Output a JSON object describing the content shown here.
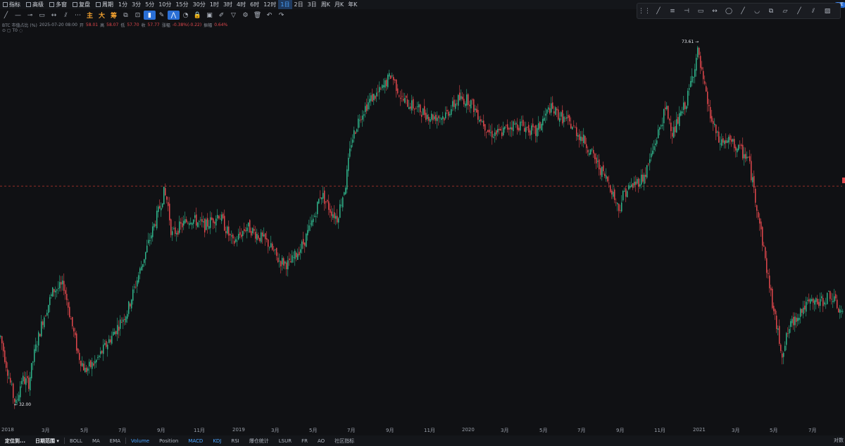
{
  "topbar": {
    "items": [
      {
        "icon": "indicator-icon",
        "label": "指标"
      },
      {
        "icon": "advanced-icon",
        "label": "高级"
      },
      {
        "icon": "multi-window-icon",
        "label": "多窗"
      },
      {
        "icon": "replay-icon",
        "label": "复盘"
      },
      {
        "icon": "period-icon",
        "label": "周期"
      }
    ],
    "intervals": [
      "1分",
      "3分",
      "5分",
      "10分",
      "15分",
      "30分",
      "1时",
      "3时",
      "4时",
      "6时",
      "12时",
      "1日",
      "2日",
      "3日",
      "周K",
      "月K",
      "年K"
    ],
    "active_interval": "1日",
    "badge": "AIE"
  },
  "toolbar": {
    "tools": [
      {
        "name": "trend-line-icon",
        "glyph": "╱"
      },
      {
        "name": "horizontal-line-icon",
        "glyph": "—"
      },
      {
        "name": "ray-icon",
        "glyph": "⊸"
      },
      {
        "name": "rectangle-icon",
        "glyph": "▭"
      },
      {
        "name": "range-icon",
        "glyph": "↔"
      },
      {
        "name": "parallel-channel-icon",
        "glyph": "⫽"
      },
      {
        "name": "dotted-line-icon",
        "glyph": "⋯"
      }
    ],
    "chinese_tools": [
      "主",
      "大",
      "筹"
    ],
    "tools2": [
      {
        "name": "layout-icon",
        "glyph": "⧉"
      },
      {
        "name": "screenshot-icon",
        "glyph": "⊡"
      },
      {
        "name": "bookmark-icon",
        "glyph": "▮",
        "selected": true
      },
      {
        "name": "ruler-icon",
        "glyph": "✎"
      },
      {
        "name": "magnet-icon",
        "glyph": "⋀",
        "selected": true
      },
      {
        "name": "eye-icon",
        "glyph": "◔"
      },
      {
        "name": "lock-icon",
        "glyph": "🔒"
      },
      {
        "name": "clipboard-icon",
        "glyph": "▣"
      },
      {
        "name": "edit-icon",
        "glyph": "✐"
      },
      {
        "name": "filter-icon",
        "glyph": "▽"
      },
      {
        "name": "settings-icon",
        "glyph": "⚙"
      },
      {
        "name": "trash-icon",
        "glyph": "🗑"
      },
      {
        "name": "undo-icon",
        "glyph": "↶"
      },
      {
        "name": "redo-icon",
        "glyph": "↷"
      }
    ]
  },
  "float_toolbar": [
    "⋮⋮",
    "╱",
    "≡",
    "⊣",
    "▭",
    "↔",
    "◯",
    "╱",
    "◡",
    "⧉",
    "▱",
    "╱",
    "⫽",
    "▨"
  ],
  "info": {
    "symbol": "BTC 市值占比 (%)",
    "datetime": "2025-07-20 08:00",
    "open_label": "开",
    "open": "58.01",
    "high_label": "高",
    "high": "58.07",
    "low_label": "低",
    "low": "57.70",
    "close_label": "收",
    "close": "57.77",
    "change_label": "涨幅",
    "change": "-0.38%(-0.22)",
    "amplitude_label": "振幅",
    "amplitude": "0.64%",
    "sub": "T0"
  },
  "annotations": {
    "high_value": "73.61",
    "low_value": "32.00"
  },
  "chart_data": {
    "type": "candlestick",
    "title": "",
    "x_range": [
      "2018-01-01",
      "2021-09-15"
    ],
    "ylim": [
      30,
      76
    ],
    "reference_line": 57.77,
    "colors": {
      "up": "#2fb38a",
      "down": "#e0474c",
      "grid": "none"
    },
    "x_ticks": [
      "2018",
      "3月",
      "5月",
      "7月",
      "9月",
      "11月",
      "2019",
      "3月",
      "5月",
      "7月",
      "9月",
      "11月",
      "2020",
      "3月",
      "5月",
      "7月",
      "9月",
      "11月",
      "2021",
      "3月",
      "5月",
      "7月"
    ],
    "anchors": [
      {
        "t": 0,
        "v": 40
      },
      {
        "t": 10,
        "v": 36
      },
      {
        "t": 18,
        "v": 33
      },
      {
        "t": 22,
        "v": 32
      },
      {
        "t": 30,
        "v": 35
      },
      {
        "t": 40,
        "v": 34.5
      },
      {
        "t": 48,
        "v": 38
      },
      {
        "t": 60,
        "v": 42
      },
      {
        "t": 75,
        "v": 45.5
      },
      {
        "t": 90,
        "v": 46
      },
      {
        "t": 100,
        "v": 42
      },
      {
        "t": 110,
        "v": 38
      },
      {
        "t": 120,
        "v": 36
      },
      {
        "t": 135,
        "v": 37
      },
      {
        "t": 150,
        "v": 39
      },
      {
        "t": 165,
        "v": 41
      },
      {
        "t": 180,
        "v": 43
      },
      {
        "t": 195,
        "v": 47
      },
      {
        "t": 210,
        "v": 51
      },
      {
        "t": 225,
        "v": 55
      },
      {
        "t": 232,
        "v": 57
      },
      {
        "t": 237,
        "v": 56
      },
      {
        "t": 243,
        "v": 52
      },
      {
        "t": 255,
        "v": 53
      },
      {
        "t": 270,
        "v": 54
      },
      {
        "t": 290,
        "v": 53
      },
      {
        "t": 310,
        "v": 54.5
      },
      {
        "t": 330,
        "v": 51
      },
      {
        "t": 350,
        "v": 53
      },
      {
        "t": 365,
        "v": 52
      },
      {
        "t": 380,
        "v": 51
      },
      {
        "t": 395,
        "v": 49
      },
      {
        "t": 410,
        "v": 48.5
      },
      {
        "t": 430,
        "v": 51
      },
      {
        "t": 445,
        "v": 54
      },
      {
        "t": 455,
        "v": 57
      },
      {
        "t": 468,
        "v": 55
      },
      {
        "t": 478,
        "v": 54
      },
      {
        "t": 490,
        "v": 58
      },
      {
        "t": 498,
        "v": 63
      },
      {
        "t": 510,
        "v": 66
      },
      {
        "t": 525,
        "v": 68
      },
      {
        "t": 540,
        "v": 69
      },
      {
        "t": 555,
        "v": 71
      },
      {
        "t": 570,
        "v": 68
      },
      {
        "t": 590,
        "v": 67
      },
      {
        "t": 610,
        "v": 66
      },
      {
        "t": 630,
        "v": 66
      },
      {
        "t": 650,
        "v": 68
      },
      {
        "t": 665,
        "v": 68
      },
      {
        "t": 680,
        "v": 66
      },
      {
        "t": 695,
        "v": 64
      },
      {
        "t": 710,
        "v": 64
      },
      {
        "t": 725,
        "v": 65
      },
      {
        "t": 740,
        "v": 65
      },
      {
        "t": 760,
        "v": 64
      },
      {
        "t": 780,
        "v": 67
      },
      {
        "t": 795,
        "v": 66
      },
      {
        "t": 810,
        "v": 65
      },
      {
        "t": 830,
        "v": 63
      },
      {
        "t": 850,
        "v": 60
      },
      {
        "t": 865,
        "v": 58
      },
      {
        "t": 878,
        "v": 55
      },
      {
        "t": 885,
        "v": 57
      },
      {
        "t": 900,
        "v": 58
      },
      {
        "t": 915,
        "v": 59
      },
      {
        "t": 930,
        "v": 63
      },
      {
        "t": 945,
        "v": 67
      },
      {
        "t": 955,
        "v": 64
      },
      {
        "t": 965,
        "v": 66
      },
      {
        "t": 975,
        "v": 68
      },
      {
        "t": 983,
        "v": 71
      },
      {
        "t": 990,
        "v": 73.6
      },
      {
        "t": 998,
        "v": 70
      },
      {
        "t": 1008,
        "v": 66
      },
      {
        "t": 1020,
        "v": 63
      },
      {
        "t": 1035,
        "v": 63
      },
      {
        "t": 1050,
        "v": 62
      },
      {
        "t": 1062,
        "v": 61
      },
      {
        "t": 1075,
        "v": 55
      },
      {
        "t": 1090,
        "v": 47
      },
      {
        "t": 1100,
        "v": 42
      },
      {
        "t": 1110,
        "v": 38
      },
      {
        "t": 1120,
        "v": 41
      },
      {
        "t": 1135,
        "v": 43
      },
      {
        "t": 1150,
        "v": 44
      },
      {
        "t": 1165,
        "v": 44
      },
      {
        "t": 1178,
        "v": 45
      },
      {
        "t": 1192,
        "v": 43
      }
    ]
  },
  "bottombar": {
    "items": [
      {
        "label": "定位到...",
        "style": "strong",
        "name": "locate-button"
      },
      {
        "label": "日期范围 ▾",
        "style": "strong",
        "name": "date-range-dropdown"
      },
      {
        "sep": true
      },
      {
        "label": "BOLL",
        "name": "indicator-boll"
      },
      {
        "label": "MA",
        "name": "indicator-ma"
      },
      {
        "label": "EMA",
        "name": "indicator-ema"
      },
      {
        "sep": true
      },
      {
        "label": "Volume",
        "style": "active",
        "name": "indicator-volume"
      },
      {
        "label": "Position",
        "name": "indicator-position"
      },
      {
        "label": "MACD",
        "style": "active",
        "name": "indicator-macd"
      },
      {
        "label": "KDJ",
        "style": "active",
        "name": "indicator-kdj"
      },
      {
        "label": "RSI",
        "name": "indicator-rsi"
      },
      {
        "label": "爆仓统计",
        "name": "indicator-liquidation"
      },
      {
        "label": "LSUR",
        "name": "indicator-lsur"
      },
      {
        "label": "FR",
        "name": "indicator-fr"
      },
      {
        "label": "AO",
        "name": "indicator-ao"
      },
      {
        "label": "社区指标",
        "name": "indicator-community"
      }
    ],
    "log": "对数"
  }
}
